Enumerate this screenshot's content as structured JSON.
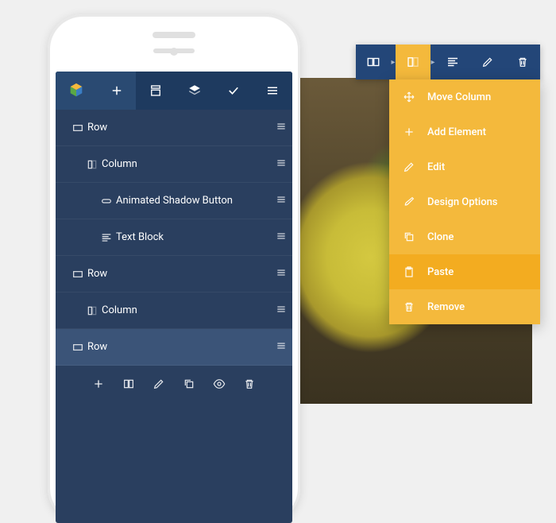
{
  "colors": {
    "phone_bg": "#2a3f5f",
    "toolbar_bg": "#234678",
    "accent": "#f4b93c",
    "accent_hover": "#f3ac20"
  },
  "tree": {
    "items": [
      {
        "icon": "row",
        "label": "Row",
        "indent": 1
      },
      {
        "icon": "column",
        "label": "Column",
        "indent": 2
      },
      {
        "icon": "button",
        "label": "Animated Shadow Button",
        "indent": 3
      },
      {
        "icon": "text",
        "label": "Text Block",
        "indent": 3
      },
      {
        "icon": "row",
        "label": "Row",
        "indent": 1
      },
      {
        "icon": "column",
        "label": "Column",
        "indent": 2
      },
      {
        "icon": "row",
        "label": "Row",
        "indent": 1,
        "selected": true
      }
    ]
  },
  "dropdown": {
    "items": [
      {
        "icon": "move",
        "label": "Move Column"
      },
      {
        "icon": "plus",
        "label": "Add Element"
      },
      {
        "icon": "pencil",
        "label": "Edit"
      },
      {
        "icon": "brush",
        "label": "Design Options"
      },
      {
        "icon": "clone",
        "label": "Clone"
      },
      {
        "icon": "paste",
        "label": "Paste",
        "hover": true
      },
      {
        "icon": "trash",
        "label": "Remove"
      }
    ]
  }
}
